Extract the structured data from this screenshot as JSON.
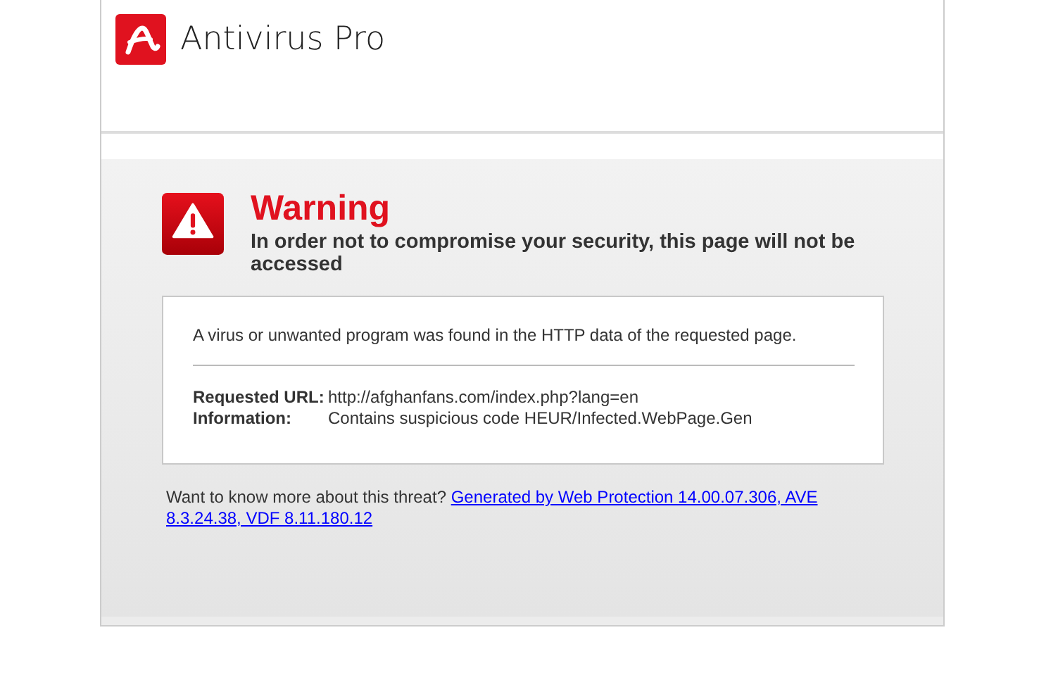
{
  "header": {
    "product": "Antivirus Pro"
  },
  "warning": {
    "title": "Warning",
    "subtitle": "In order not to compromise your security, this page will not be accessed"
  },
  "details": {
    "message": "A virus or unwanted program was found in the HTTP data of the requested page.",
    "fields": [
      {
        "label": "Requested URL:",
        "value": "http://afghanfans.com/index.php?lang=en"
      },
      {
        "label": "Information:",
        "value": "Contains suspicious code HEUR/Infected.WebPage.Gen"
      }
    ]
  },
  "footer": {
    "question": "Want to know more about this threat?",
    "link_lines": [
      "Generated by Web Protection 14.00.07.306, AVE",
      "8.3.24.38, VDF 8.11.180.12"
    ]
  }
}
